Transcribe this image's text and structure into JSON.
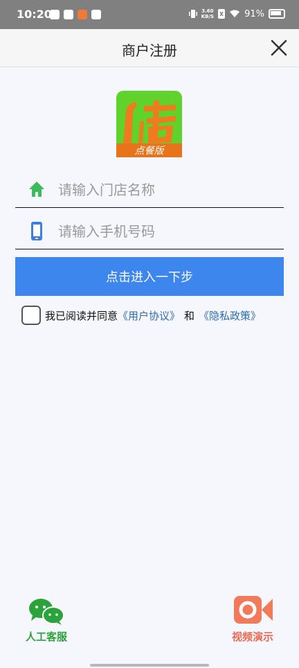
{
  "status_bar": {
    "time": "10:20",
    "network_speed_value": "3.60",
    "network_speed_unit": "KB/S",
    "battery": "91%"
  },
  "header": {
    "title": "商户注册",
    "close_icon": "close-icon"
  },
  "logo": {
    "caption": "点餐版",
    "colors": {
      "green": "#5fd32c",
      "orange": "#e8731a"
    }
  },
  "form": {
    "store_name": {
      "placeholder": "请输入门店名称",
      "value": "",
      "icon": "home-icon",
      "icon_color": "#3dbb5c"
    },
    "phone": {
      "placeholder": "请输入手机号码",
      "value": "",
      "icon": "phone-icon",
      "icon_color": "#3d7fe0"
    },
    "next_button": "点击进入一下步"
  },
  "agreement": {
    "checked": false,
    "prefix": "我已阅读并同意",
    "user_agreement": "《用户协议》",
    "and": "和",
    "privacy_policy": "《隐私政策》"
  },
  "footer": {
    "service_label": "人工客服",
    "service_icon": "wechat-icon",
    "video_label": "视频演示",
    "video_icon": "video-camera-icon"
  },
  "colors": {
    "primary_button": "#3d86ee",
    "link": "#2b6cb0",
    "service_green": "#2aa33a",
    "video_orange": "#e86a52"
  }
}
